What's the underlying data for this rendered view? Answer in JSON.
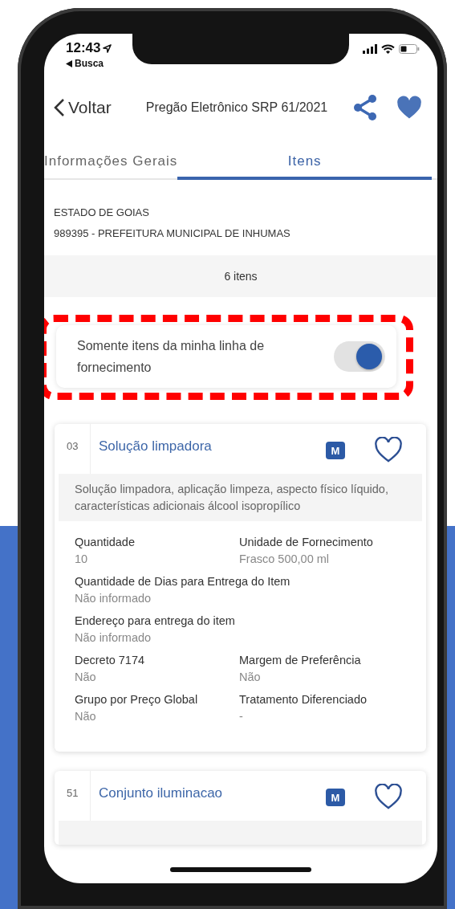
{
  "status_bar": {
    "time": "12:43",
    "back_app": "Busca"
  },
  "header": {
    "back": "Voltar",
    "title": "Pregão Eletrônico SRP 61/2021",
    "favorited": true
  },
  "tabs": [
    {
      "label": "Informações Gerais",
      "selected": false
    },
    {
      "label": "Itens",
      "selected": true
    }
  ],
  "organization": {
    "state": "ESTADO DE GOIAS",
    "unit": "989395 - PREFEITURA MUNICIPAL DE INHUMAS"
  },
  "count": "6 itens",
  "filter": {
    "label": "Somente itens da minha linha de fornecimento",
    "on": true
  },
  "items": [
    {
      "number": "03",
      "title": "Solução limpadora",
      "badge": "M",
      "favorited": false,
      "description": "Solução limpadora, aplicação limpeza, aspecto físico líquido, características adicionais álcool isopropílico",
      "fields": [
        {
          "label": "Quantidade",
          "value": "10",
          "kind": "half"
        },
        {
          "label": "Unidade de Fornecimento",
          "value": "Frasco 500,00 ml",
          "kind": "half"
        },
        {
          "label": "Quantidade de Dias para Entrega do Item",
          "value": "Não informado",
          "kind": "full"
        },
        {
          "label": "Endereço para entrega do item",
          "value": "Não informado",
          "kind": "full"
        },
        {
          "label": "Decreto 7174",
          "value": "Não",
          "kind": "half"
        },
        {
          "label": "Margem de Preferência",
          "value": "Não",
          "kind": "half"
        },
        {
          "label": "Grupo por Preço Global",
          "value": "Não",
          "kind": "half"
        },
        {
          "label": "Tratamento Diferenciado",
          "value": "-",
          "kind": "half"
        }
      ]
    },
    {
      "number": "51",
      "title": "Conjunto iluminacao",
      "badge": "M",
      "favorited": false
    }
  ]
}
